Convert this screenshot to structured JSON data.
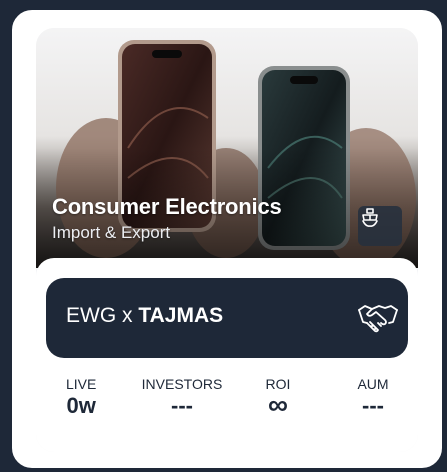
{
  "hero": {
    "title": "Consumer Electronics",
    "subtitle": "Import & Export",
    "badge_icon": "shipping-boat-icon"
  },
  "deal": {
    "prefix": "EWG x ",
    "partner": "TAJMAS",
    "icon": "handshake-icon"
  },
  "stats": {
    "live_label": "LIVE",
    "live_value": "0w",
    "investors_label": "INVESTORS",
    "investors_value": "---",
    "roi_label": "ROI",
    "roi_value": "∞",
    "aum_label": "AUM",
    "aum_value": "---"
  },
  "colors": {
    "navy": "#1e2838",
    "card_bg": "#ffffff",
    "inner_bg": "#f2f3f5"
  }
}
